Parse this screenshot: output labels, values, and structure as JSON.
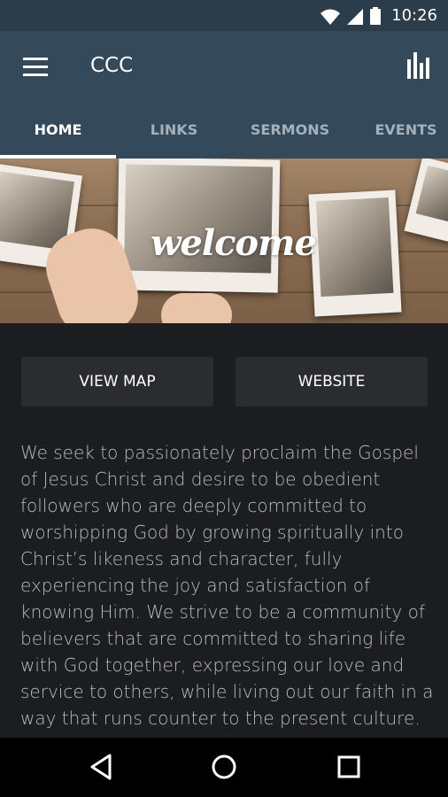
{
  "status_bar": {
    "time": "10:26"
  },
  "app_bar": {
    "title": "CCC"
  },
  "tabs": [
    {
      "label": "HOME"
    },
    {
      "label": "LINKS"
    },
    {
      "label": "SERMONS"
    },
    {
      "label": "EVENTS"
    }
  ],
  "hero": {
    "text": "welcome"
  },
  "buttons": {
    "view_map": "VIEW MAP",
    "website": "WEBSITE"
  },
  "content": {
    "description": "We seek to passionately proclaim the Gospel of Jesus Christ and desire to be obedient followers who are deeply committed to worshipping God by growing spiritually into Christ’s likeness and character, fully experiencing the joy and satisfaction of knowing Him. We strive to be a community of believers that are committed to sharing life with God together, expressing our love and service to others, while living out our faith in a way that runs counter to the present culture."
  }
}
